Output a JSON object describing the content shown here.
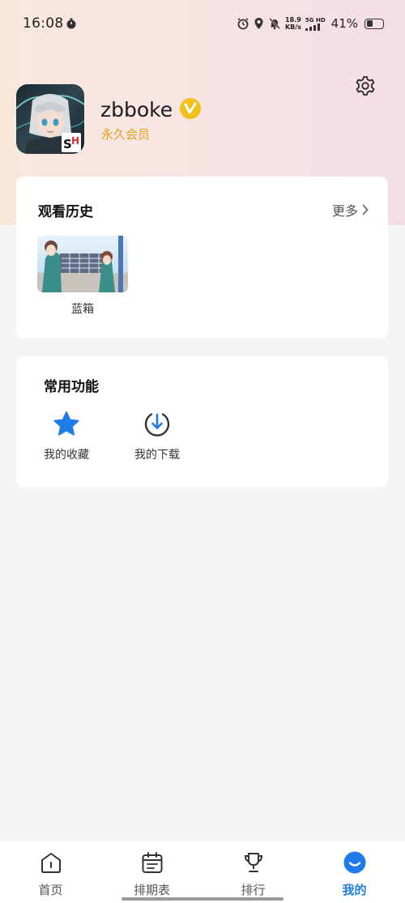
{
  "status_bar": {
    "time": "16:08",
    "net_speed_value": "18.9",
    "net_speed_unit": "KB/s",
    "net_type": "5G HD",
    "battery_percent": "41%",
    "battery_level": 0.41
  },
  "profile": {
    "username": "zbboke",
    "membership": "永久会员",
    "verified_badge": "V",
    "avatar_badge": "SH"
  },
  "history": {
    "title": "观看历史",
    "more_label": "更多",
    "items": [
      {
        "label": "蓝箱"
      }
    ]
  },
  "functions": {
    "title": "常用功能",
    "items": [
      {
        "label": "我的收藏",
        "icon": "star-icon"
      },
      {
        "label": "我的下载",
        "icon": "download-icon"
      }
    ]
  },
  "bottom_nav": {
    "items": [
      {
        "label": "首页",
        "icon": "home-icon",
        "active": false
      },
      {
        "label": "排期表",
        "icon": "calendar-icon",
        "active": false
      },
      {
        "label": "排行",
        "icon": "trophy-icon",
        "active": false
      },
      {
        "label": "我的",
        "icon": "profile-icon",
        "active": true
      }
    ]
  },
  "colors": {
    "accent": "#1e7be7",
    "member_gold": "#e3a21a",
    "verified_gold": "#f2c21b"
  }
}
